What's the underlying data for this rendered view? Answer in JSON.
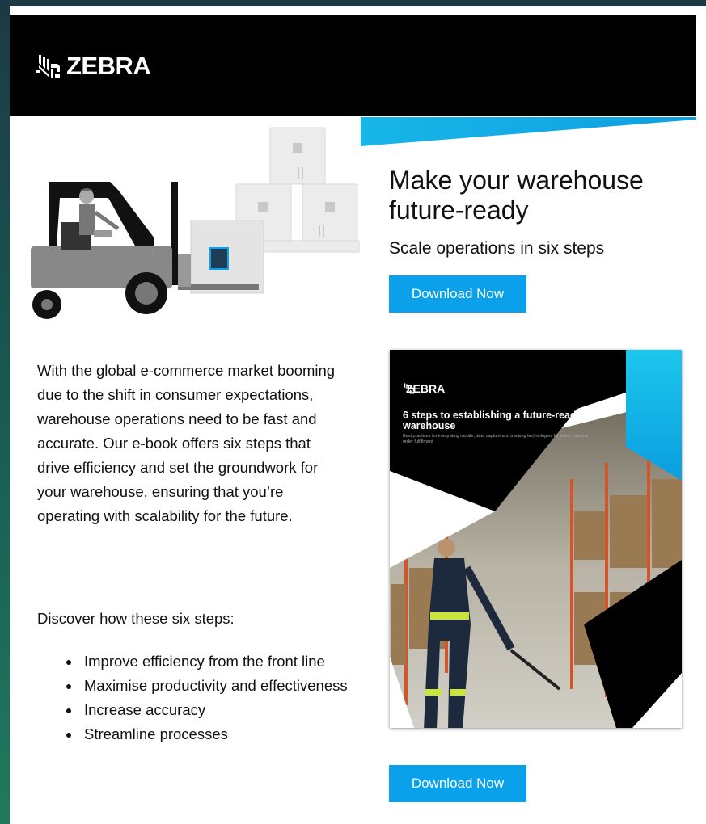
{
  "brand": {
    "name": "ZEBRA",
    "logo_icon": "zebra-head-icon",
    "accent_color": "#0aa0ea"
  },
  "hero": {
    "headline": "Make your warehouse future-ready",
    "subhead": "Scale operations in six steps",
    "cta_label": "Download Now"
  },
  "body": {
    "paragraph": "With the global e-commerce market booming due to the shift in consumer expectations, warehouse operations need to be fast and accurate. Our e-book offers six steps that drive efficiency and set the groundwork for your warehouse, ensuring that you’re operating with scalability for the future.",
    "discover": "Discover how these six steps:",
    "bullets": [
      "Improve efficiency from the front line",
      "Maximise productivity and effectiveness",
      "Increase accuracy",
      "Streamline processes"
    ]
  },
  "ebook_cover": {
    "brand": "ZEBRA",
    "title": "6 steps to establishing a future-ready warehouse",
    "subtitle": "Best practices for integrating mobile, data capture and tracking technologies for faster, smarter order fulfillment"
  },
  "footer_cta": {
    "label": "Download Now"
  }
}
